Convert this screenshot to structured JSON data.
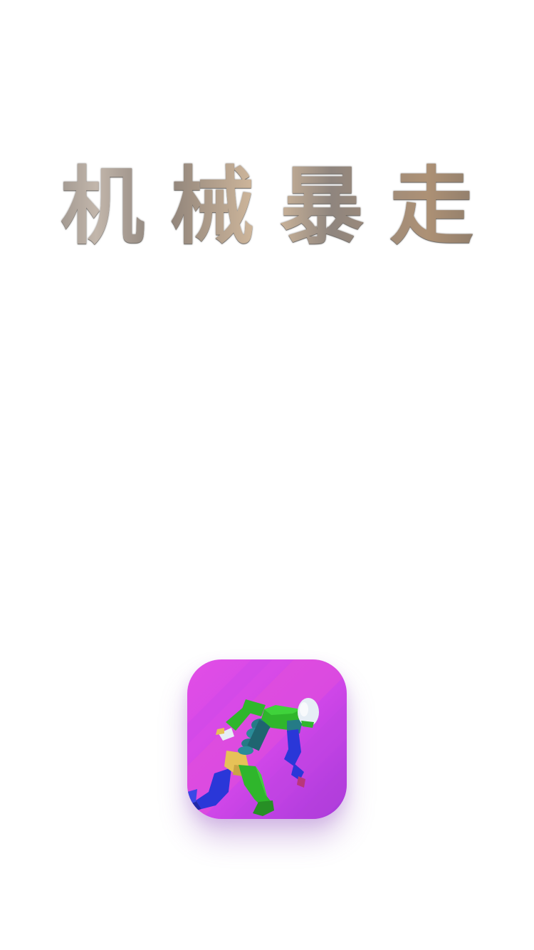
{
  "app": {
    "title": "机械暴走"
  },
  "icon": {
    "name": "app-icon-running-robot",
    "colors": {
      "background_top": "#d447ea",
      "background_bottom": "#b23fde",
      "accent_pink": "#ee4fce",
      "robot_green": "#2fb62c",
      "robot_blue": "#2a37d8",
      "robot_teal": "#257b86",
      "robot_gold": "#e6c257",
      "head_white": "#e6eef5"
    }
  }
}
